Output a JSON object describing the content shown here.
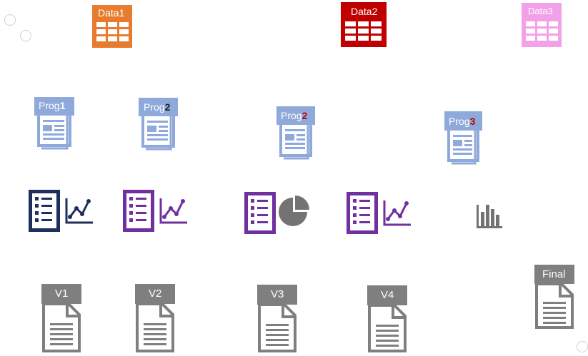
{
  "data_sources": [
    {
      "name": "Data1",
      "color": "#E87C2E"
    },
    {
      "name": "Data2",
      "color": "#C00000"
    },
    {
      "name": "Data3",
      "color": "#F2A1E8"
    }
  ],
  "programs": [
    {
      "prefix": "Prog",
      "suffix": "1",
      "suffix_color": "#ffffff",
      "color": "#8FA9DB"
    },
    {
      "prefix": "Prog",
      "suffix": "2",
      "suffix_color": "#1F1F1F",
      "color": "#8FA9DB"
    },
    {
      "prefix": "Prog",
      "suffix": "2",
      "suffix_color": "#C00000",
      "color": "#8FA9DB"
    },
    {
      "prefix": "Prog",
      "suffix": "3",
      "suffix_color": "#C00000",
      "color": "#8FA9DB"
    }
  ],
  "analysis_icons": [
    {
      "type": "list-line-chart",
      "color": "#1F2F5C"
    },
    {
      "type": "list-line-chart",
      "color": "#7030A0"
    },
    {
      "type": "list-pie-chart",
      "color": "#7030A0",
      "pie_color": "#737373"
    },
    {
      "type": "list-line-chart",
      "color": "#7030A0"
    },
    {
      "type": "bar-chart",
      "color": "#737373"
    }
  ],
  "versions": [
    {
      "name": "V1"
    },
    {
      "name": "V2"
    },
    {
      "name": "V3"
    },
    {
      "name": "V4"
    }
  ],
  "final": {
    "name": "Final"
  },
  "doc_color": "#7F7F7F"
}
